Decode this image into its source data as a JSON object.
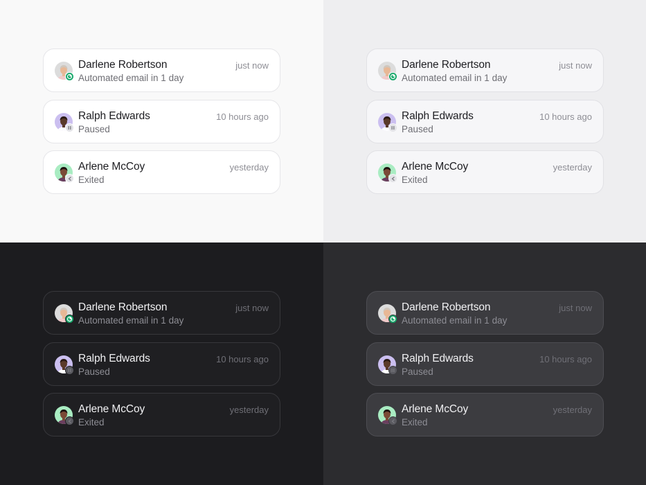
{
  "notifications": [
    {
      "name": "Darlene Robertson",
      "status": "Automated email in 1 day",
      "time": "just now",
      "avatar_bg": "#dcdcdc",
      "badge": "active"
    },
    {
      "name": "Ralph Edwards",
      "status": "Paused",
      "time": "10 hours ago",
      "avatar_bg": "#cbbff0",
      "badge": "paused"
    },
    {
      "name": "Arlene McCoy",
      "status": "Exited",
      "time": "yesterday",
      "avatar_bg": "#a9ecc2",
      "badge": "exited"
    }
  ],
  "themes": [
    "light",
    "light-gray",
    "dark",
    "dark-gray"
  ],
  "colors": {
    "active_badge": "#16a86a",
    "paused_badge": "#e3e3e7"
  }
}
